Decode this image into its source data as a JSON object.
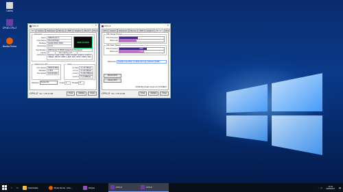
{
  "desktop": {
    "icons": [
      {
        "label": "Lixeira",
        "color": "#d8d8d8"
      },
      {
        "label": "CPUID CPU-Z",
        "color": "#6a3fa0"
      },
      {
        "label": "Mozilla Firefox",
        "color": "#e66000"
      }
    ]
  },
  "cpuz_main": {
    "title": "CPU-Z",
    "tabs": [
      "CPU",
      "Caches",
      "Mainboard",
      "Memory",
      "SPD",
      "Graphics",
      "Bench",
      "About"
    ],
    "processor_group": "Processor",
    "fields": [
      {
        "label": "Name",
        "value": "AMD Ryzen 5"
      },
      {
        "label": "Code Name",
        "value": "Summit Ridge"
      },
      {
        "label": "Package",
        "value": "Socket AM4 (1331)"
      },
      {
        "label": "Technology",
        "value": "14 nm"
      },
      {
        "label": "Specification",
        "value": "AMD Ryzen 5 1500X Quad-Core Processor"
      },
      {
        "label": "Family",
        "value": "F"
      },
      {
        "label": "Ext. Family",
        "value": "17"
      },
      {
        "label": "Instructions",
        "value": "MMX(+), SSE, SSE2, SSE3, SSSE3, SSE4.1, SSE4.2, SSE4A, x86-64, AMD-V, AES, AVX, AVX2, FMA3, SHA"
      }
    ],
    "clocks_group": "Clocks (Core #0)",
    "clocks": [
      {
        "label": "Core Speed",
        "value": "3500.00 MHz"
      },
      {
        "label": "Multiplier",
        "value": "x 35.0"
      },
      {
        "label": "Bus Speed",
        "value": "100.00 MHz"
      }
    ],
    "cache_group": "Cache",
    "caches": [
      {
        "label": "L1 Data",
        "value": "4 x 32 KBytes"
      },
      {
        "label": "L1 Inst.",
        "value": "4 x 64 KBytes"
      },
      {
        "label": "Level 2",
        "value": "4 x 512 KBytes"
      },
      {
        "label": "Level 3",
        "value": "2 x 8 MBytes"
      }
    ],
    "brand": "AMD RYZEN",
    "selection_label": "Selection",
    "selection_value": "Socket #1",
    "cores_label": "Cores",
    "cores_value": "4",
    "threads_label": "Threads",
    "threads_value": "8",
    "version": "Ver. 1.79.0.x64",
    "tools_button": "Tools",
    "validate_button": "Validate",
    "close_button": "Close"
  },
  "cpuz_bench": {
    "title": "CPU-Z",
    "tabs": [
      "CPU",
      "Caches",
      "Mainboard",
      "Memory",
      "SPD",
      "Graphics",
      "Bench",
      "About"
    ],
    "single_group": "CPU Single Thread",
    "multi_group": "CPU Multi Thread",
    "this_processor": "This Processor",
    "reference_label": "Reference",
    "single_this": 0.42,
    "single_ref": 0.38,
    "multi_this": 0.62,
    "multi_ref": 0.55,
    "multi_this_text": "1878",
    "multi_ref_text": "1,75x",
    "reference_value": "Intel(R) Core(TM) i7-7700K CPU @ 4.20GHz (4C/8T)",
    "bench_cpu_button": "Bench CPU",
    "stress_cpu_button": "Stress CPU",
    "bench_version": "CPUID Benchmark Version 17.01.64 BETA",
    "version": "Ver. 1.79.0.x64",
    "tools_button": "Tools",
    "validate_button": "Validate",
    "close_button": "Close"
  },
  "taskbar": {
    "items": [
      {
        "label": "Downloads",
        "color": "#f0c040",
        "active": false
      },
      {
        "label": "Modo Demo - Fire...",
        "color": "#e66000",
        "active": false
      },
      {
        "label": "Gbytes",
        "color": "#9050c0",
        "active": false
      },
      {
        "label": "CPU-Z",
        "color": "#6a3fa0",
        "active": true
      },
      {
        "label": "CPU-Z",
        "color": "#6a3fa0",
        "active": true
      }
    ],
    "time": "17:42",
    "date": "13/05/2017"
  },
  "colors": {
    "bar_this": "#4a2a8a",
    "bar_ref": "#c070c0"
  }
}
